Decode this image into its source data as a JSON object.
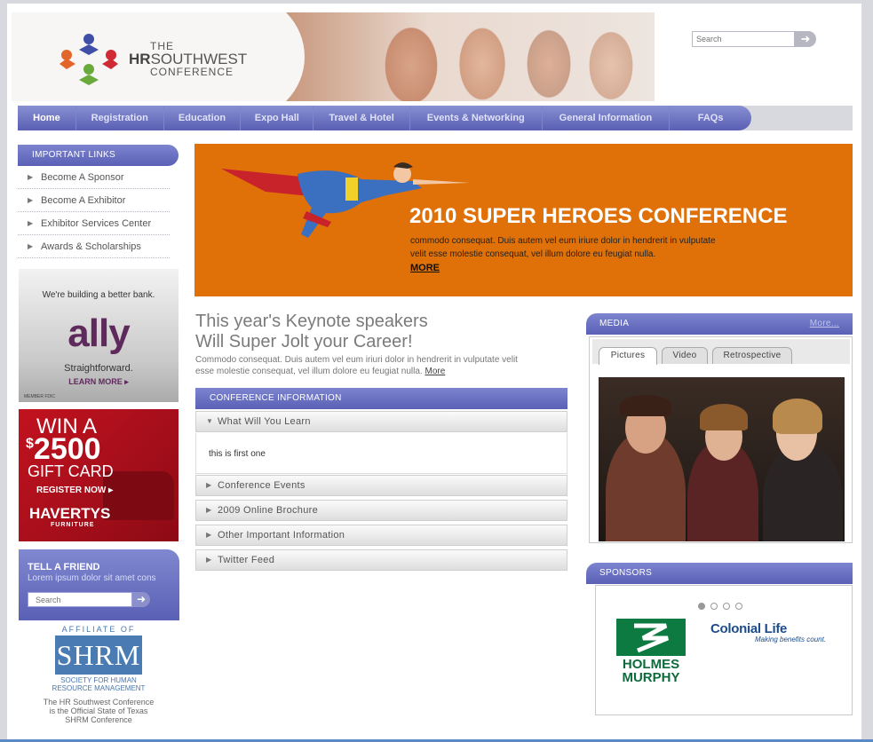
{
  "header": {
    "logo_line1": "THE",
    "logo_line2_bold": "HR",
    "logo_line2": "SOUTHWEST",
    "logo_line3": "CONFERENCE",
    "search_placeholder": "Search"
  },
  "nav": {
    "items": [
      {
        "label": "Home",
        "active": true
      },
      {
        "label": "Registration"
      },
      {
        "label": "Education"
      },
      {
        "label": "Expo Hall"
      },
      {
        "label": "Travel & Hotel"
      },
      {
        "label": "Events & Networking"
      },
      {
        "label": "General Information"
      },
      {
        "label": "FAQs"
      }
    ]
  },
  "sidebar": {
    "heading": "IMPORTANT LINKS",
    "links": [
      {
        "label": "Become A Sponsor"
      },
      {
        "label": "Become A Exhibitor"
      },
      {
        "label": "Exhibitor Services Center"
      },
      {
        "label": "Awards & Scholarships"
      }
    ],
    "ad_ally": {
      "tagline": "We're building a better bank.",
      "brand": "ally",
      "sub": "Straightforward.",
      "cta": "LEARN MORE ▸",
      "legal": "MEMBER FDIC"
    },
    "ad_havertys": {
      "win": "WIN A",
      "currency": "$",
      "amount": "2500",
      "gift": "GIFT CARD",
      "cta": "REGISTER NOW ▸",
      "brand": "HAVERTYS",
      "brand_sub": "FURNITURE"
    },
    "tell_friend": {
      "title": "TELL A FRIEND",
      "text": "Lorem ipsum dolor sit amet cons",
      "search_placeholder": "Search"
    },
    "shrm": {
      "affiliate": "AFFILIATE OF",
      "logo": "SHRM",
      "society": "SOCIETY FOR HUMAN",
      "society2": "RESOURCE MANAGEMENT",
      "note1": "The HR Southwest Conference",
      "note2": "is the Official State of Texas",
      "note3": "SHRM Conference"
    }
  },
  "banner": {
    "title": "2010 SUPER HEROES CONFERENCE",
    "text": "commodo consequat. Duis autem vel eum iriure dolor in hendrerit in vulputate velit esse molestie consequat, vel illum dolore eu feugiat nulla.",
    "more": "MORE",
    "bg_color": "#e07109"
  },
  "keynote": {
    "title1": "This year's Keynote speakers",
    "title2": "Will Super Jolt your Career!",
    "text": "Commodo consequat. Duis autem vel eum iriuri dolor in hendrerit in vulputate velit esse molestie consequat, vel illum dolore eu feugiat nulla.",
    "more": "More"
  },
  "conference_info": {
    "heading": "CONFERENCE INFORMATION",
    "open_item": {
      "label": "What Will You Learn",
      "content": "this is first one"
    },
    "items": [
      {
        "label": "Conference Events"
      },
      {
        "label": "2009 Online Brochure"
      },
      {
        "label": "Other Important Information"
      },
      {
        "label": "Twitter Feed"
      }
    ]
  },
  "media": {
    "heading": "MEDIA",
    "more": "More...",
    "tabs": [
      {
        "label": "Pictures",
        "active": true
      },
      {
        "label": "Video"
      },
      {
        "label": "Retrospective"
      }
    ]
  },
  "sponsors": {
    "heading": "SPONSORS",
    "dots_total": 4,
    "dots_active": 1,
    "sponsor1_line1": "HOLMES",
    "sponsor1_line2": "MURPHY",
    "sponsor2_name": "Colonial Life",
    "sponsor2_tag": "Making benefits count."
  },
  "colors": {
    "nav_purple": "#5a60b5",
    "banner_orange": "#e07109",
    "ally_purple": "#5e2a5c",
    "havertys_red": "#c2121f"
  }
}
